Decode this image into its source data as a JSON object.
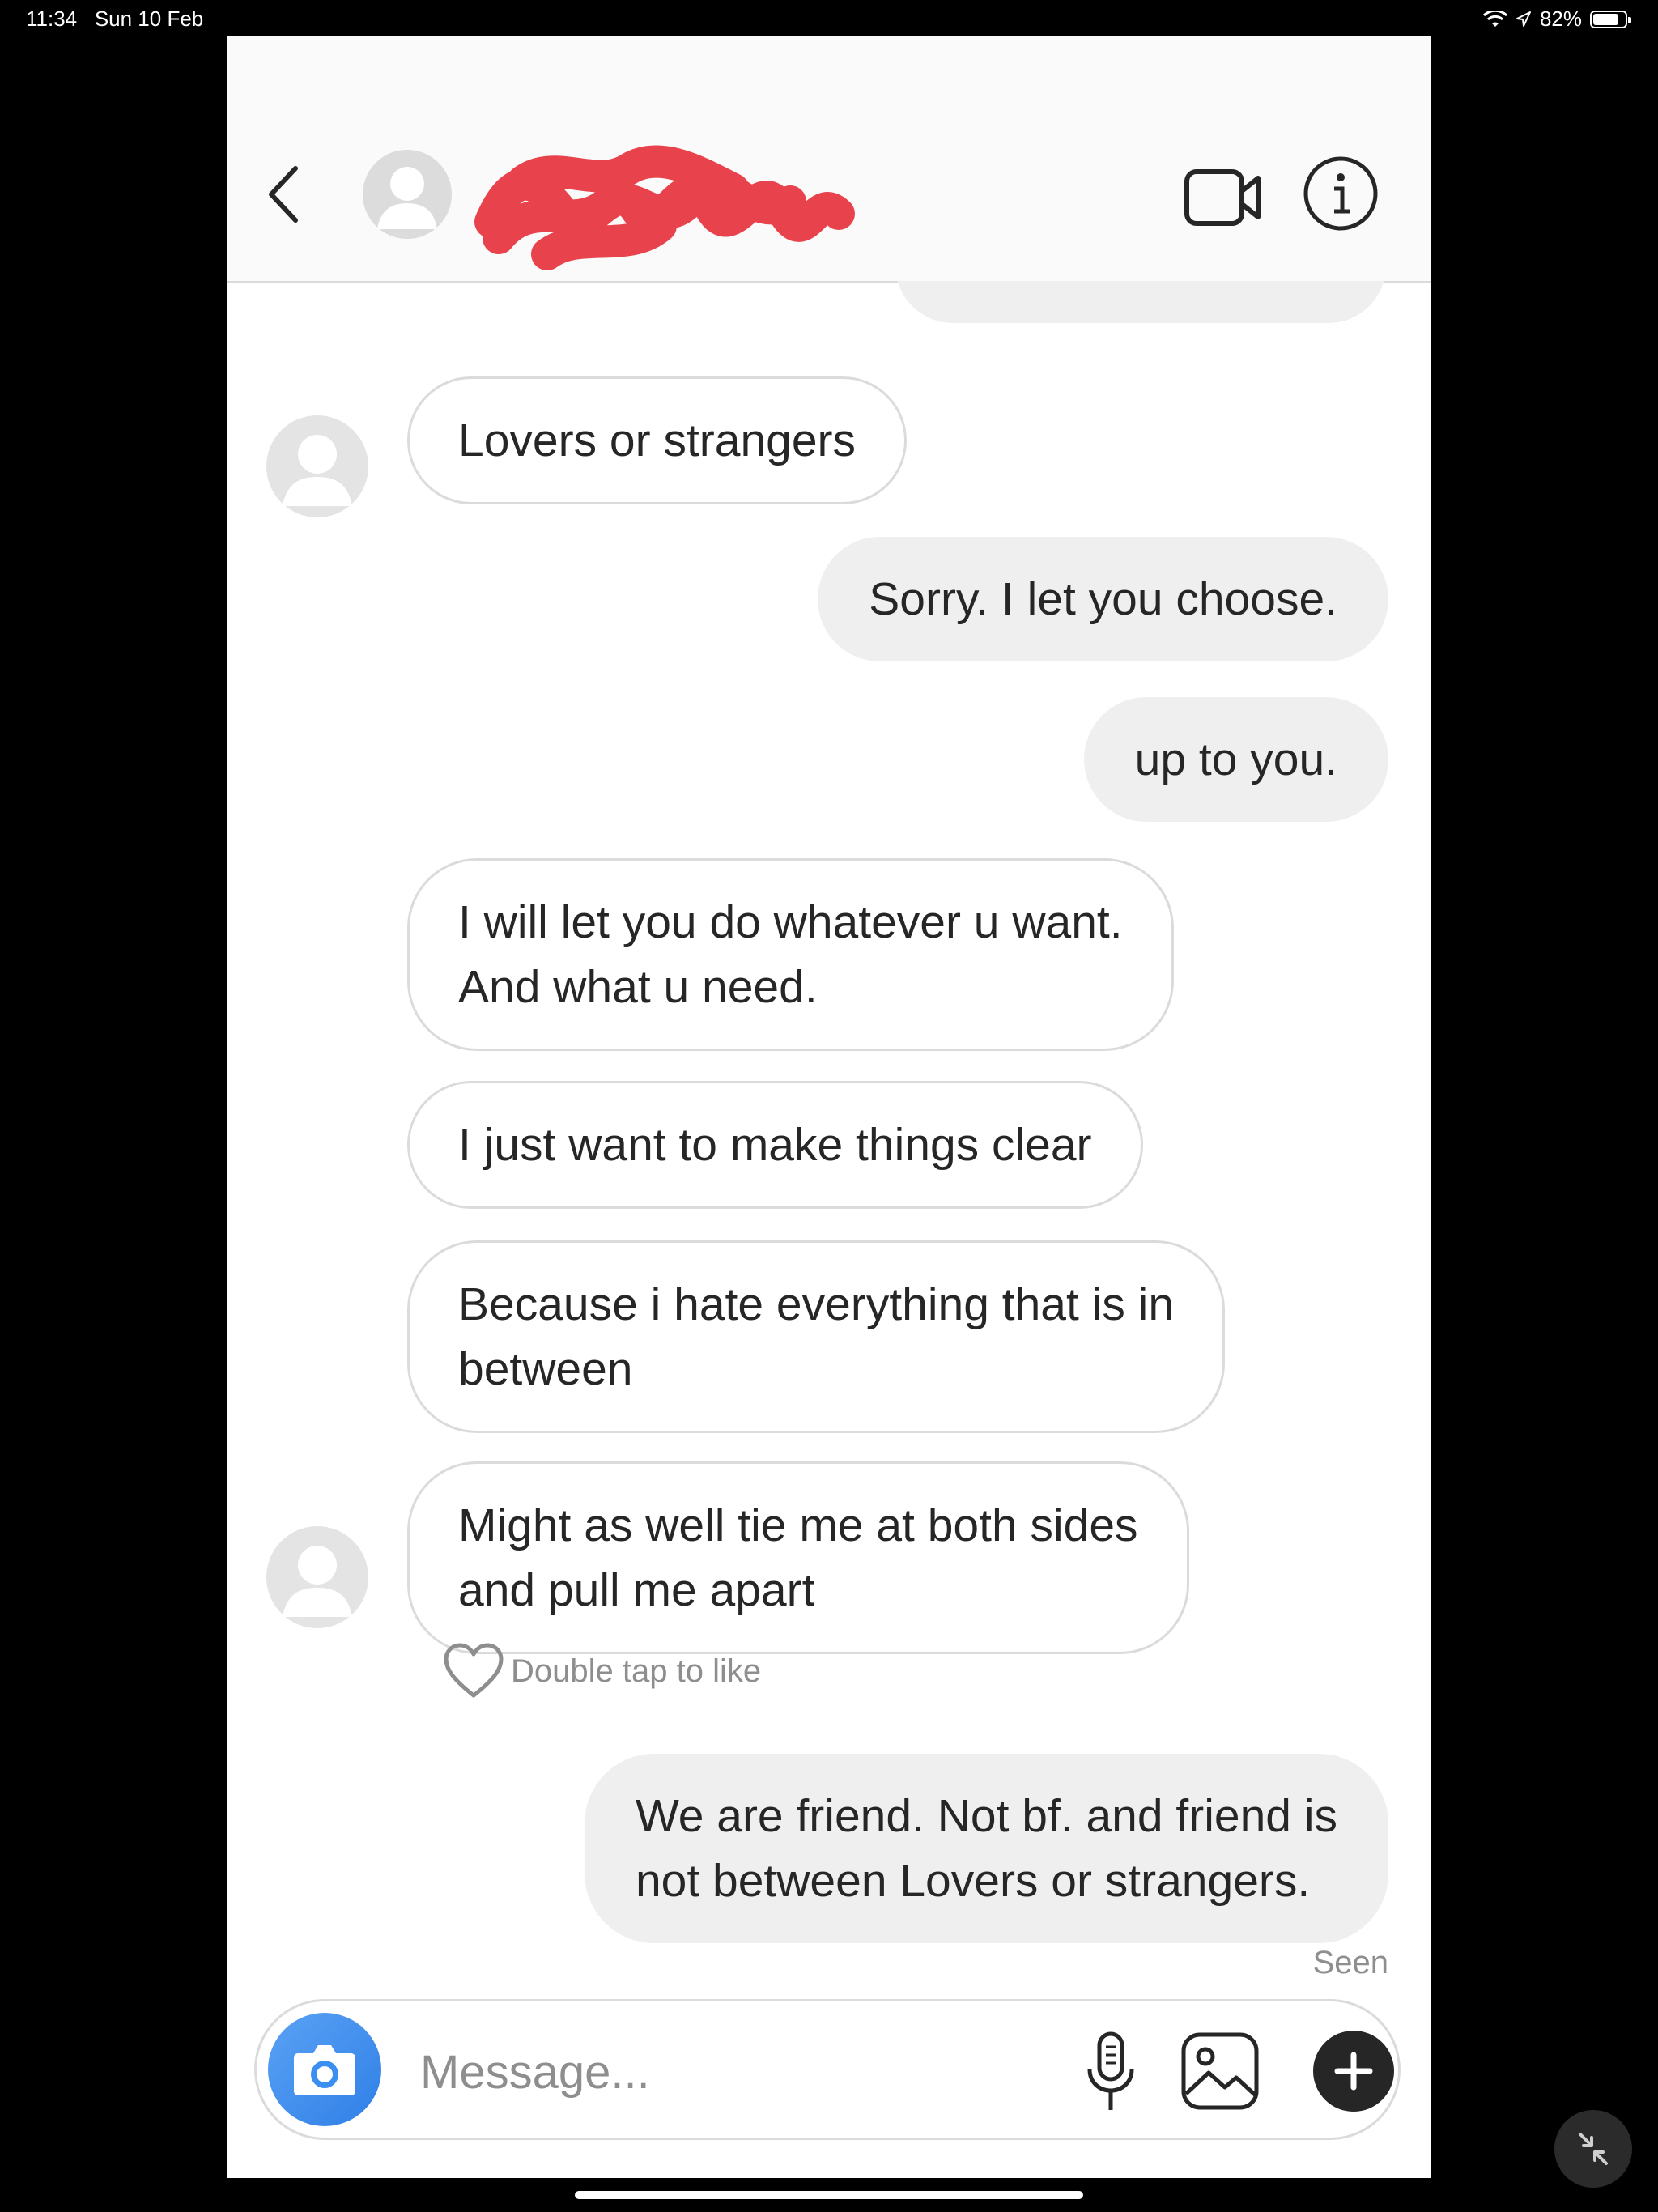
{
  "status_bar": {
    "time": "11:34",
    "date": "Sun 10 Feb",
    "battery": "82%",
    "battery_level": 0.82
  },
  "header": {
    "icons": [
      "chevron-left-icon",
      "user-avatar-icon",
      "video-camera-icon",
      "info-icon"
    ],
    "username_redacted": true
  },
  "messages": [
    {
      "direction": "in",
      "lines": [
        "Lovers or strangers"
      ]
    },
    {
      "direction": "out",
      "lines": [
        "Sorry. I let you choose."
      ]
    },
    {
      "direction": "out",
      "lines": [
        "up to you."
      ]
    },
    {
      "direction": "in",
      "lines": [
        "I will let you do whatever u want.",
        "And what u need."
      ]
    },
    {
      "direction": "in",
      "lines": [
        "I just want to make things clear"
      ]
    },
    {
      "direction": "in",
      "lines": [
        "Because i hate everything that is in",
        "between"
      ]
    },
    {
      "direction": "in",
      "lines": [
        "Might as well tie me at both sides",
        "and pull me apart"
      ]
    },
    {
      "direction": "out",
      "lines": [
        "We are friend. Not bf. and friend is",
        "not between Lovers or strangers."
      ]
    }
  ],
  "like_hint": "Double tap to like",
  "seen_label": "Seen",
  "composer": {
    "placeholder": "Message...",
    "icons": [
      "camera-icon",
      "microphone-icon",
      "gallery-icon",
      "plus-icon"
    ]
  },
  "colors": {
    "incoming_border": "#dbdbdb",
    "outgoing_bg": "#efefef",
    "camera_blue": "#3b8ff0",
    "redaction": "#e8434c"
  }
}
